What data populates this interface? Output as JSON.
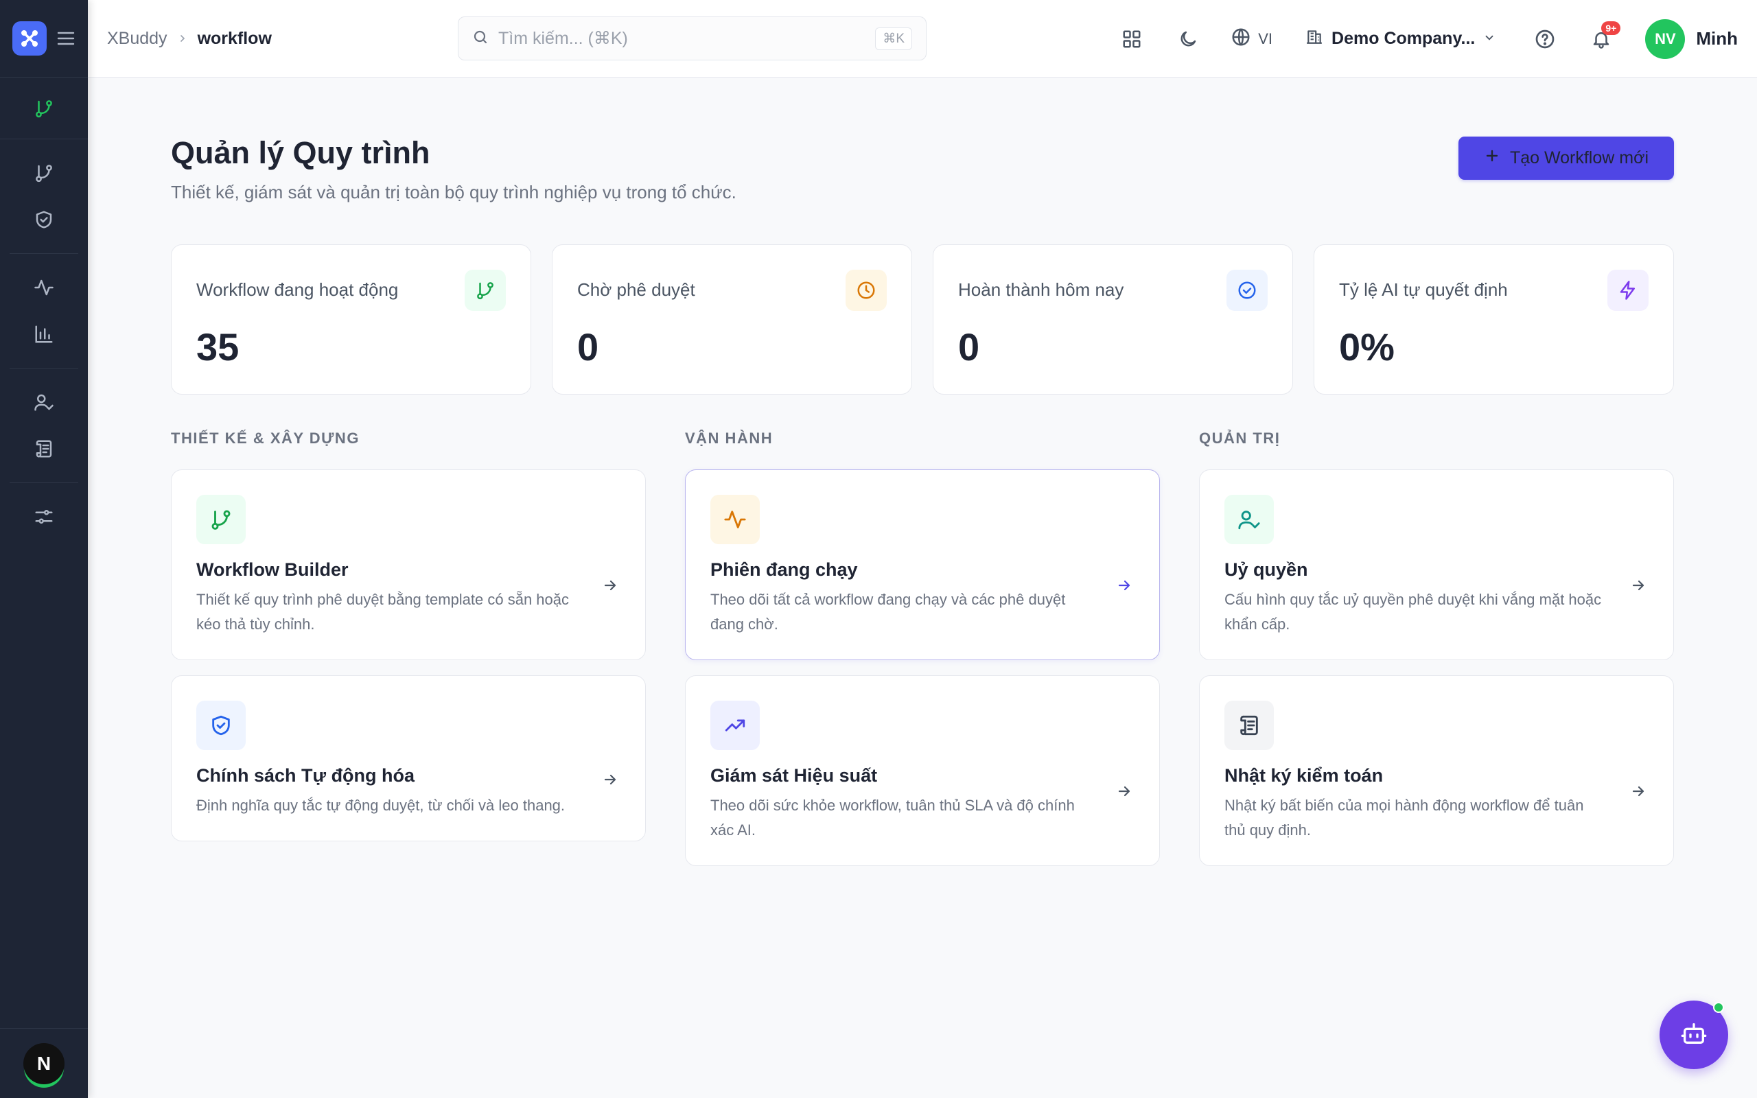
{
  "header": {
    "breadcrumb": {
      "root": "XBuddy",
      "current": "workflow"
    },
    "search": {
      "placeholder": "Tìm kiếm... (⌘K)",
      "shortcut": "⌘K"
    },
    "language": "VI",
    "company": "Demo Company...",
    "notifications_badge": "9+",
    "user": {
      "initials": "NV",
      "name": "Minh"
    }
  },
  "sidebar": {
    "avatar_letter": "N",
    "icons": [
      "workflow-icon",
      "branch-icon",
      "shield-check-icon",
      "activity-icon",
      "bar-chart-icon",
      "user-check-icon",
      "scroll-icon",
      "sliders-icon"
    ]
  },
  "page": {
    "title": "Quản lý Quy trình",
    "subtitle": "Thiết kế, giám sát và quản trị toàn bộ quy trình nghiệp vụ trong tổ chức.",
    "create_button": "Tạo Workflow mới"
  },
  "stats": [
    {
      "label": "Workflow đang hoạt động",
      "value": "35",
      "icon": "branch-icon",
      "color": "#16a34a",
      "bg": "#ecfdf3"
    },
    {
      "label": "Chờ phê duyệt",
      "value": "0",
      "icon": "clock-icon",
      "color": "#d97706",
      "bg": "#fef6e4"
    },
    {
      "label": "Hoàn thành hôm nay",
      "value": "0",
      "icon": "check-circle-icon",
      "color": "#2563eb",
      "bg": "#eef4ff"
    },
    {
      "label": "Tỷ lệ AI tự quyết định",
      "value": "0%",
      "icon": "zap-icon",
      "color": "#7c3aed",
      "bg": "#f3f0ff"
    }
  ],
  "sections": [
    {
      "title": "THIẾT KẾ & XÂY DỰNG",
      "cards": [
        {
          "title": "Workflow Builder",
          "desc": "Thiết kế quy trình phê duyệt bằng template có sẵn hoặc kéo thả tùy chỉnh.",
          "icon": "branch-icon"
        },
        {
          "title": "Chính sách Tự động hóa",
          "desc": "Định nghĩa quy tắc tự động duyệt, từ chối và leo thang.",
          "icon": "shield-check-icon"
        }
      ]
    },
    {
      "title": "VẬN HÀNH",
      "cards": [
        {
          "title": "Phiên đang chạy",
          "desc": "Theo dõi tất cả workflow đang chạy và các phê duyệt đang chờ.",
          "icon": "activity-icon"
        },
        {
          "title": "Giám sát Hiệu suất",
          "desc": "Theo dõi sức khỏe workflow, tuân thủ SLA và độ chính xác AI.",
          "icon": "trending-up-icon"
        }
      ]
    },
    {
      "title": "QUẢN TRỊ",
      "cards": [
        {
          "title": "Uỷ quyền",
          "desc": "Cấu hình quy tắc uỷ quyền phê duyệt khi vắng mặt hoặc khẩn cấp.",
          "icon": "user-check-icon"
        },
        {
          "title": "Nhật ký kiểm toán",
          "desc": "Nhật ký bất biến của mọi hành động workflow để tuân thủ quy định.",
          "icon": "scroll-icon"
        }
      ]
    }
  ]
}
